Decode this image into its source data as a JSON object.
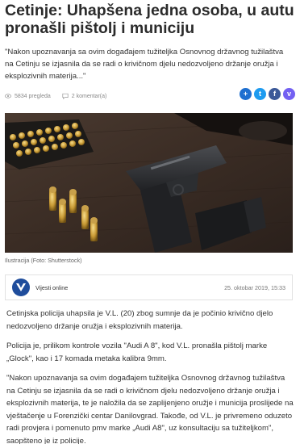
{
  "article": {
    "title": "Cetinje: Uhapšena jedna osoba, u autu pronašli pištolj i municiju",
    "lead": "\"Nakon upoznavanja sa ovim događajem tužiteljka Osnovnog državnog tužilaštva na Cetinju se izjasnila da se radi o krivičnom djelu nedozvoljeno držanje oružja i eksplozivnih materija...\"",
    "views": "5834 pregleda",
    "comments": "2 komentar(a)",
    "image_caption": "Ilustracija (Foto: Shutterstock)",
    "author": "Vijesti online",
    "date": "25. oktobar 2019, 15:33",
    "paragraphs": [
      "Cetinjska policija uhapsila je V.L. (20) zbog sumnje da je počinio krivično djelo nedozvoljeno držanje oružja i eksplozivnih materija.",
      "Policija je, prilikom kontrole vozila \"Audi A 8\", kod V.L. pronašla pištolj marke „Glock\", kao i 17 komada metaka kalibra 9mm.",
      "\"Nakon upoznavanja sa ovim događajem tužiteljka Osnovnog državnog tužilaštva na Cetinju se izjasnila da se radi o krivičnom djelu nedozvoljeno držanje oružja i eksplozivnih materija, te je naložila da se zaplijenjeno oružje i municija proslijede na vještačenje u Forenzički centar Danilovgrad. Takođe, od V.L. je privremeno oduzeto radi provjera i pomenuto pmv marke „Audi A8\", uz konsultaciju sa tužiteljkom\", saopšteno je iz policije."
    ]
  },
  "share": {
    "buttons": [
      {
        "icon": "plus-icon",
        "glyph": "+",
        "color": "#1e6fd0"
      },
      {
        "icon": "twitter-icon",
        "glyph": "t",
        "color": "#1d9bf0"
      },
      {
        "icon": "facebook-icon",
        "glyph": "f",
        "color": "#3b5998"
      },
      {
        "icon": "viber-icon",
        "glyph": "v",
        "color": "#7360f2"
      }
    ]
  },
  "colors": {
    "author_logo": "#1f4d9c"
  }
}
